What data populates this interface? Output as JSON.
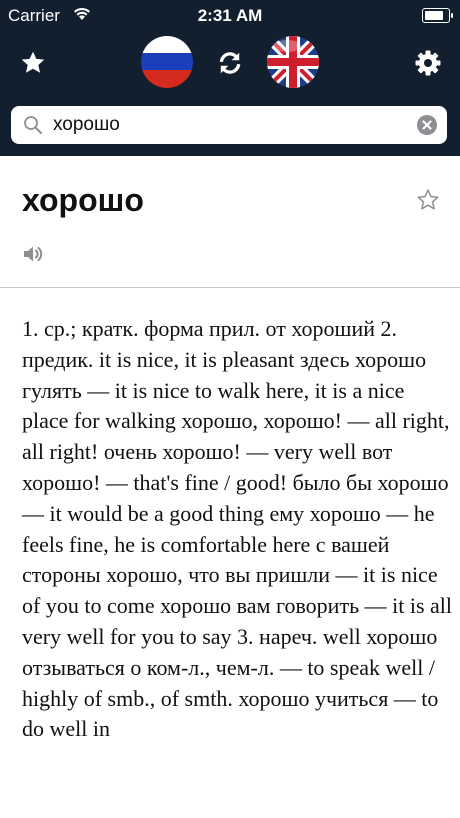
{
  "status_bar": {
    "carrier": "Carrier",
    "time": "2:31 AM",
    "battery_level": 0.9
  },
  "nav": {
    "icons": [
      "star-icon",
      "russian-flag-icon",
      "swap-icon",
      "uk-flag-icon",
      "gear-icon"
    ],
    "colors": {
      "bar": "#111f2e",
      "icon": "#ffffff"
    }
  },
  "search": {
    "value": "хорошо"
  },
  "entry": {
    "headword": "хорошо",
    "definition": "1. ср.; кратк. форма прил. от хороший 2. предик. it is nice, it is pleasant здесь хорошо гулять — it is nice to walk here, it is a nice place for walking хорошо, хорошо! — all right, all right! очень хорошо! — very well вот хорошо! — that's fine / good! было бы хорошо — it would be a good thing ему хорошо — he feels fine, he is comfortable here с вашей стороны хорошо, что вы пришли — it is nice of you to come хорошо вам говорить — it is all very well for you to say 3. нареч. well хорошо отзываться о ком-л., чем-л. — to speak well / highly of smb., of smth. хорошо учиться — to do well in"
  }
}
